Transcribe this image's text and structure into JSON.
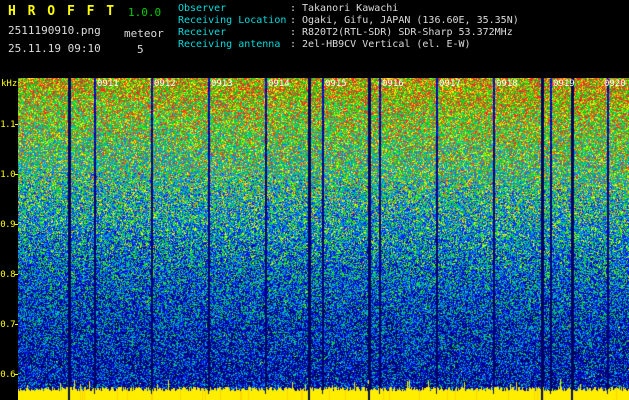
{
  "header": {
    "title": "H R O F F T",
    "version": "1.0.0",
    "filename": "2511190910.png",
    "mode": "meteor",
    "datetime": "25.11.19 09:10",
    "count": "5",
    "separator": ":",
    "info_rows": [
      {
        "label": "Observer",
        "value": "Takanori Kawachi"
      },
      {
        "label": "Receiving Location",
        "value": "Ogaki, Gifu, JAPAN (136.60E, 35.35N)"
      },
      {
        "label": "Receiver",
        "value": "R820T2(RTL-SDR) SDR-Sharp 53.372MHz"
      },
      {
        "label": "Receiving antenna",
        "value": "2el-HB9CV Vertical (el. E-W)"
      }
    ]
  },
  "spectrogram": {
    "unit_label": "kHz",
    "freq_labels": [
      "1.1",
      "1.0",
      "0.9",
      "0.8",
      "0.7",
      "0.6"
    ],
    "time_labels": [
      "0911",
      "0912",
      "0913",
      "0914",
      "0915",
      "0916",
      "0917",
      "0918",
      "0919",
      "0920"
    ]
  },
  "colors": {
    "background": "#000000",
    "title": "#ffff00",
    "version": "#00cc00",
    "info_label": "#00dcdc",
    "info_value": "#dcdcdc",
    "axis": "#ffff00",
    "time_label": "#ffffff",
    "band": "#ffee00"
  }
}
